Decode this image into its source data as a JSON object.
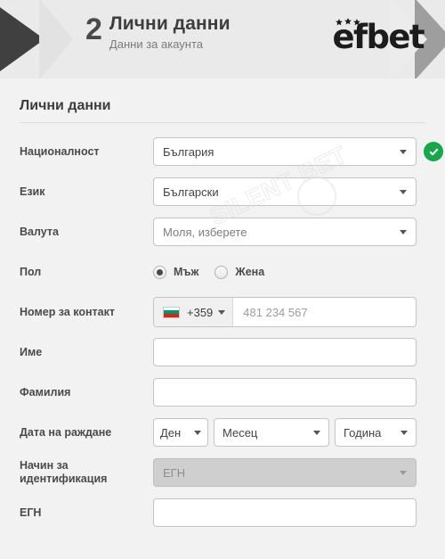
{
  "header": {
    "step_number": "2",
    "step_title": "Лични данни",
    "step_subtitle": "Данни за акаунта",
    "logo_text": "efbet",
    "colors": {
      "arrow_dark": "#404040",
      "arrow_gray": "#9e9e9e",
      "panel": "#eaeaea"
    }
  },
  "form": {
    "section_title": "Лични данни",
    "rows": {
      "nationality": {
        "label": "Националност",
        "value": "България",
        "valid_badge": "check-icon"
      },
      "language": {
        "label": "Език",
        "value": "Български"
      },
      "currency": {
        "label": "Валута",
        "value": "Моля, изберете"
      },
      "gender": {
        "label": "Пол",
        "options": [
          {
            "label": "Мъж",
            "selected": true
          },
          {
            "label": "Жена",
            "selected": false
          }
        ]
      },
      "phone": {
        "label": "Номер за контакт",
        "country_code": "+359",
        "flag": "bulgaria-flag-icon",
        "placeholder": "481 234 567",
        "value": ""
      },
      "first_name": {
        "label": "Име",
        "value": "",
        "placeholder": ""
      },
      "last_name": {
        "label": "Фамилия",
        "value": "",
        "placeholder": ""
      },
      "birth_date": {
        "label": "Дата на раждане",
        "day": "Ден",
        "month": "Месец",
        "year": "Година"
      },
      "id_method": {
        "label": "Начин за идентификация",
        "label_line1": "Начин за",
        "label_line2": "идентификация",
        "value": "ЕГН",
        "disabled": true
      },
      "egn": {
        "label": "ЕГН",
        "value": "",
        "placeholder": ""
      }
    }
  },
  "watermark": {
    "text": "SILENT BET"
  }
}
